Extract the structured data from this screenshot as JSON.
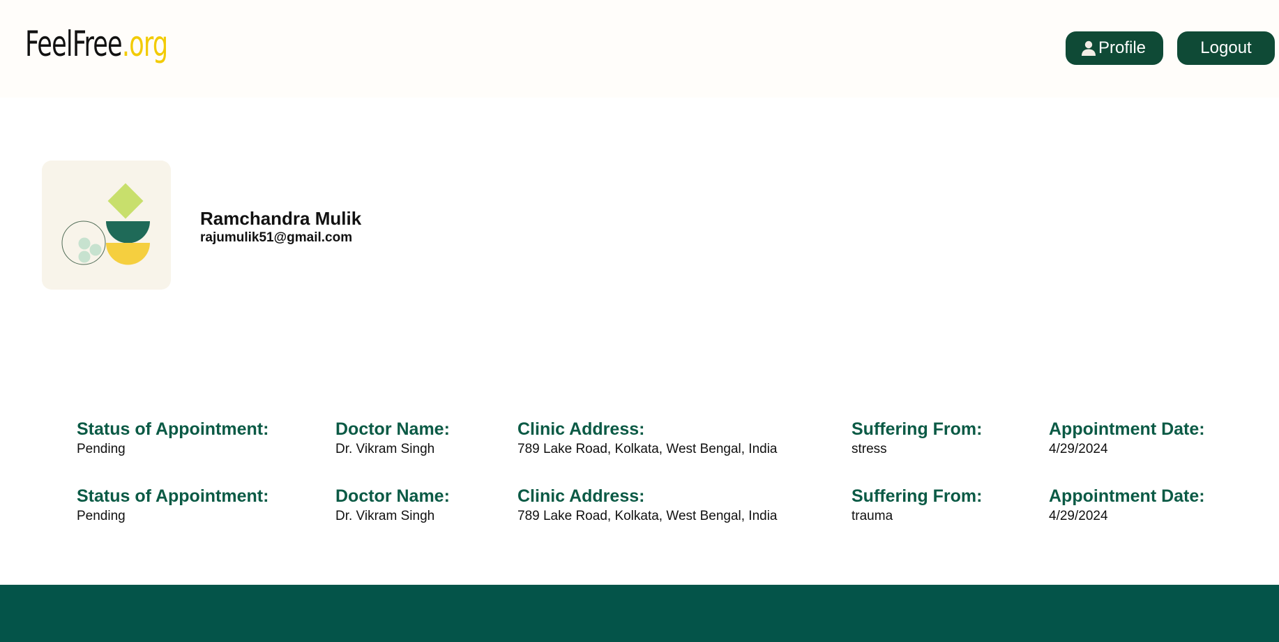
{
  "header": {
    "logo_brand": "FeelFree",
    "logo_tld": ".org",
    "profile_label": "Profile",
    "logout_label": "Logout"
  },
  "user": {
    "name": "Ramchandra Mulik",
    "email": "rajumulik51@gmail.com"
  },
  "labels": {
    "status": "Status of Appointment:",
    "doctor": "Doctor Name:",
    "address": "Clinic Address:",
    "suffering": "Suffering From:",
    "date": "Appointment Date:"
  },
  "appointments": [
    {
      "status": "Pending",
      "doctor": "Dr. Vikram Singh",
      "address": "789 Lake Road, Kolkata, West Bengal, India",
      "suffering": "stress",
      "date": "4/29/2024"
    },
    {
      "status": "Pending",
      "doctor": "Dr. Vikram Singh",
      "address": "789 Lake Road, Kolkata, West Bengal, India",
      "suffering": "trauma",
      "date": "4/29/2024"
    }
  ],
  "colors": {
    "button_bg": "#0f4a36",
    "label_green": "#0b5a45",
    "footer_bg": "#045449",
    "logo_accent": "#f2cb05"
  },
  "icons": [
    "user-icon"
  ]
}
